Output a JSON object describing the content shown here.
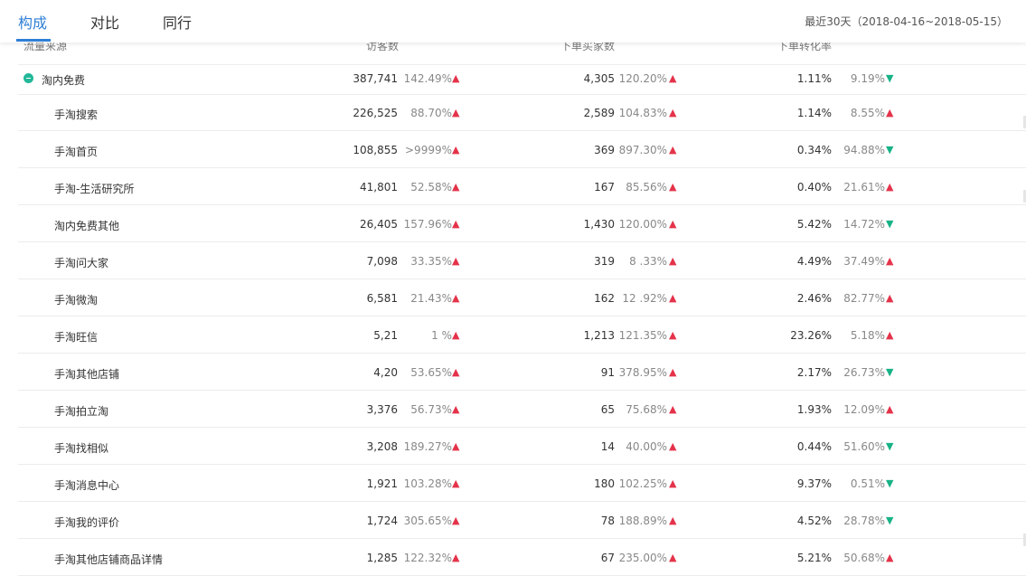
{
  "tabs": [
    {
      "label": "构成",
      "active": true
    },
    {
      "label": "对比",
      "active": false
    },
    {
      "label": "同行",
      "active": false
    }
  ],
  "date_range": "最近30天（2018-04-16~2018-05-15）",
  "columns": [
    "流量来源",
    "访客数",
    "下单买家数",
    "下单转化率"
  ],
  "colors": {
    "accent": "#2f7fd6",
    "up": "#e4334a",
    "down": "#17b286"
  },
  "rows": [
    {
      "name": "淘内免费",
      "visitors": "387,741",
      "visitors_chg": "142.49%",
      "visitors_dir": "up",
      "buyers": "4,305",
      "buyers_chg": "120.20%",
      "buyers_dir": "up",
      "rate": "1.11%",
      "rate_chg": "9.19%",
      "rate_dir": "down"
    },
    {
      "name": "手淘搜索",
      "visitors": "226,525",
      "visitors_chg": "88.70%",
      "visitors_dir": "up",
      "buyers": "2,589",
      "buyers_chg": "104.83%",
      "buyers_dir": "up",
      "rate": "1.14%",
      "rate_chg": "8.55%",
      "rate_dir": "up"
    },
    {
      "name": "手淘首页",
      "visitors": "108,855",
      "visitors_chg": ">9999%",
      "visitors_dir": "up",
      "buyers": "369",
      "buyers_chg": "897.30%",
      "buyers_dir": "up",
      "rate": "0.34%",
      "rate_chg": "94.88%",
      "rate_dir": "down"
    },
    {
      "name": "手淘-生活研究所",
      "visitors": "41,801",
      "visitors_chg": "52.58%",
      "visitors_dir": "up",
      "buyers": "167",
      "buyers_chg": "85.56%",
      "buyers_dir": "up",
      "rate": "0.40%",
      "rate_chg": "21.61%",
      "rate_dir": "up"
    },
    {
      "name": "淘内免费其他",
      "visitors": "26,405",
      "visitors_chg": "157.96%",
      "visitors_dir": "up",
      "buyers": "1,430",
      "buyers_chg": "120.00%",
      "buyers_dir": "up",
      "rate": "5.42%",
      "rate_chg": "14.72%",
      "rate_dir": "down"
    },
    {
      "name": "手淘问大家",
      "visitors": "7,098",
      "visitors_chg": "33.35%",
      "visitors_dir": "up",
      "buyers": "319",
      "buyers_chg": "8 .33%",
      "buyers_dir": "up",
      "rate": "4.49%",
      "rate_chg": "37.49%",
      "rate_dir": "up"
    },
    {
      "name": "手淘微淘",
      "visitors": "6,581",
      "visitors_chg": "21.43%",
      "visitors_dir": "up",
      "buyers": "162",
      "buyers_chg": "12 .92%",
      "buyers_dir": "up",
      "rate": "2.46%",
      "rate_chg": "82.77%",
      "rate_dir": "up"
    },
    {
      "name": "手淘旺信",
      "visitors": "5,21",
      "visitors_chg": "1  %",
      "visitors_dir": "up",
      "buyers": "1,213",
      "buyers_chg": "121.35%",
      "buyers_dir": "up",
      "rate": "23.26%",
      "rate_chg": "5.18%",
      "rate_dir": "up"
    },
    {
      "name": "手淘其他店铺",
      "visitors": "4,20",
      "visitors_chg": "53.65%",
      "visitors_dir": "up",
      "buyers": "91",
      "buyers_chg": "378.95%",
      "buyers_dir": "up",
      "rate": "2.17%",
      "rate_chg": "26.73%",
      "rate_dir": "down"
    },
    {
      "name": "手淘拍立淘",
      "visitors": "3,376",
      "visitors_chg": "56.73%",
      "visitors_dir": "up",
      "buyers": "65",
      "buyers_chg": "75.68%",
      "buyers_dir": "up",
      "rate": "1.93%",
      "rate_chg": "12.09%",
      "rate_dir": "up"
    },
    {
      "name": "手淘找相似",
      "visitors": "3,208",
      "visitors_chg": "189.27%",
      "visitors_dir": "up",
      "buyers": "14",
      "buyers_chg": "40.00%",
      "buyers_dir": "up",
      "rate": "0.44%",
      "rate_chg": "51.60%",
      "rate_dir": "down"
    },
    {
      "name": "手淘消息中心",
      "visitors": "1,921",
      "visitors_chg": "103.28%",
      "visitors_dir": "up",
      "buyers": "180",
      "buyers_chg": "102.25%",
      "buyers_dir": "up",
      "rate": "9.37%",
      "rate_chg": "0.51%",
      "rate_dir": "down"
    },
    {
      "name": "手淘我的评价",
      "visitors": "1,724",
      "visitors_chg": "305.65%",
      "visitors_dir": "up",
      "buyers": "78",
      "buyers_chg": "188.89%",
      "buyers_dir": "up",
      "rate": "4.52%",
      "rate_chg": "28.78%",
      "rate_dir": "down"
    },
    {
      "name": "手淘其他店铺商品详情",
      "visitors": "1,285",
      "visitors_chg": "122.32%",
      "visitors_dir": "up",
      "buyers": "67",
      "buyers_chg": "235.00%",
      "buyers_dir": "up",
      "rate": "5.21%",
      "rate_chg": "50.68%",
      "rate_dir": "up"
    }
  ]
}
